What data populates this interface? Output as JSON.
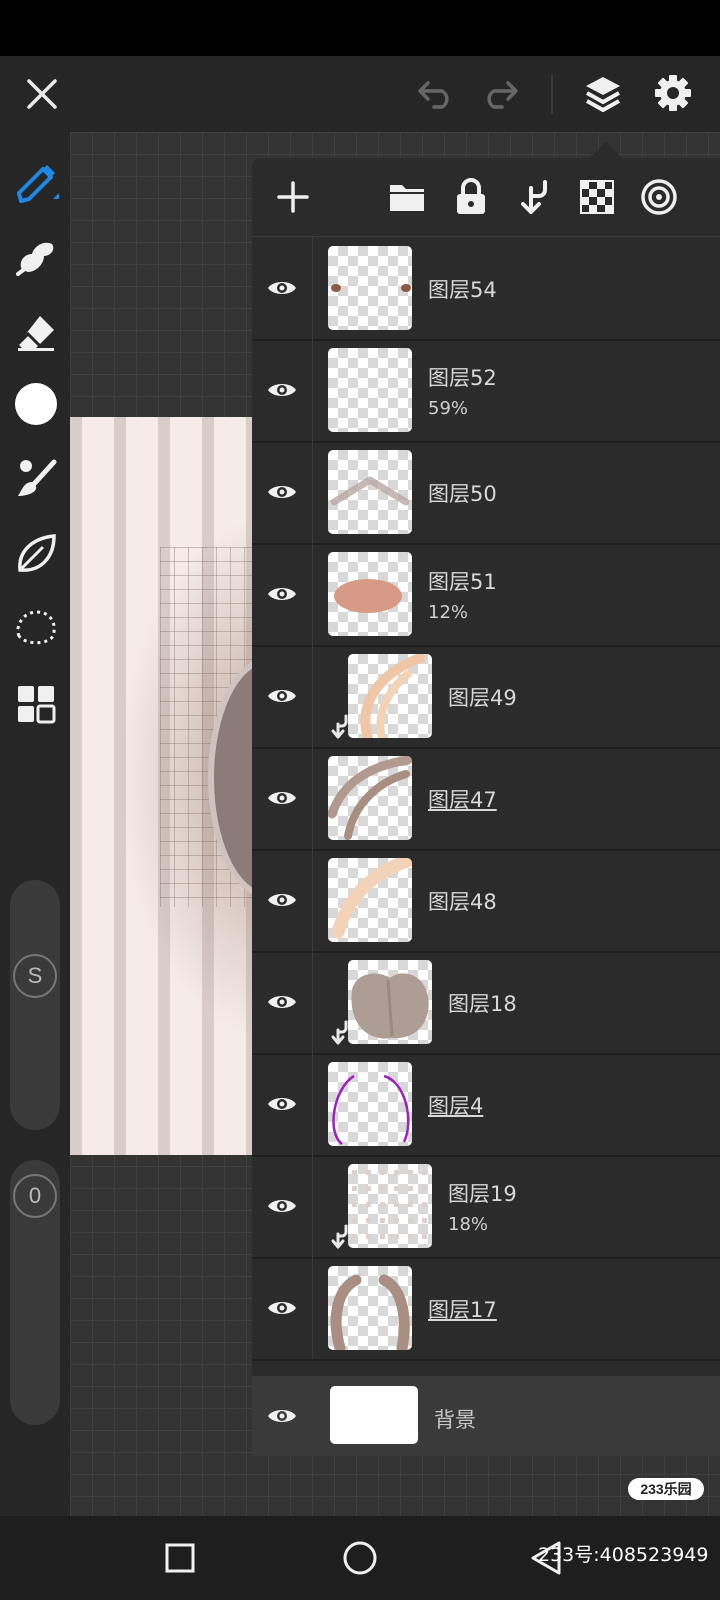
{
  "layers": [
    {
      "name": "图层54",
      "opacity": "",
      "clipped": false,
      "underlined": false,
      "thumb": "dots"
    },
    {
      "name": "图层52",
      "opacity": "59%",
      "clipped": false,
      "underlined": false,
      "thumb": "empty"
    },
    {
      "name": "图层50",
      "opacity": "",
      "clipped": false,
      "underlined": false,
      "thumb": "chevron"
    },
    {
      "name": "图层51",
      "opacity": "12%",
      "clipped": false,
      "underlined": false,
      "thumb": "blush"
    },
    {
      "name": "图层49",
      "opacity": "",
      "clipped": true,
      "underlined": false,
      "thumb": "light-strokes"
    },
    {
      "name": "图层47",
      "opacity": "",
      "clipped": false,
      "underlined": true,
      "thumb": "brown-strokes"
    },
    {
      "name": "图层48",
      "opacity": "",
      "clipped": false,
      "underlined": false,
      "thumb": "light-stroke"
    },
    {
      "name": "图层18",
      "opacity": "",
      "clipped": true,
      "underlined": false,
      "thumb": "hair-blob"
    },
    {
      "name": "图层4",
      "opacity": "",
      "clipped": false,
      "underlined": true,
      "thumb": "purple-outline"
    },
    {
      "name": "图层19",
      "opacity": "18%",
      "clipped": true,
      "underlined": false,
      "thumb": "dotted"
    },
    {
      "name": "图层17",
      "opacity": "",
      "clipped": false,
      "underlined": true,
      "thumb": "brown-brackets"
    }
  ],
  "background_layer": {
    "name": "背景"
  },
  "sliders": {
    "brush_size_label": "S",
    "opacity_label": "0"
  },
  "watermark": {
    "badge": "233乐园",
    "id_text": "233号:408523949"
  },
  "colors": {
    "accent": "#1e88e5",
    "panel": "#2b2b2b",
    "toolbar": "#262626",
    "current_color": "#ffffff"
  },
  "icons": {
    "topbar": [
      "close-icon",
      "undo-icon",
      "redo-icon",
      "layers-icon",
      "settings-icon"
    ],
    "tools": [
      "pen-icon",
      "smudge-icon",
      "eraser-icon",
      "color-swatch",
      "brush-icon",
      "leaf-icon",
      "lasso-icon",
      "grid-icon"
    ],
    "layers_toolbar": [
      "add-icon",
      "folder-icon",
      "lock-icon",
      "merge-down-icon",
      "transparency-icon",
      "blend-icon"
    ],
    "nav": [
      "recents-icon",
      "home-icon",
      "back-icon"
    ]
  }
}
